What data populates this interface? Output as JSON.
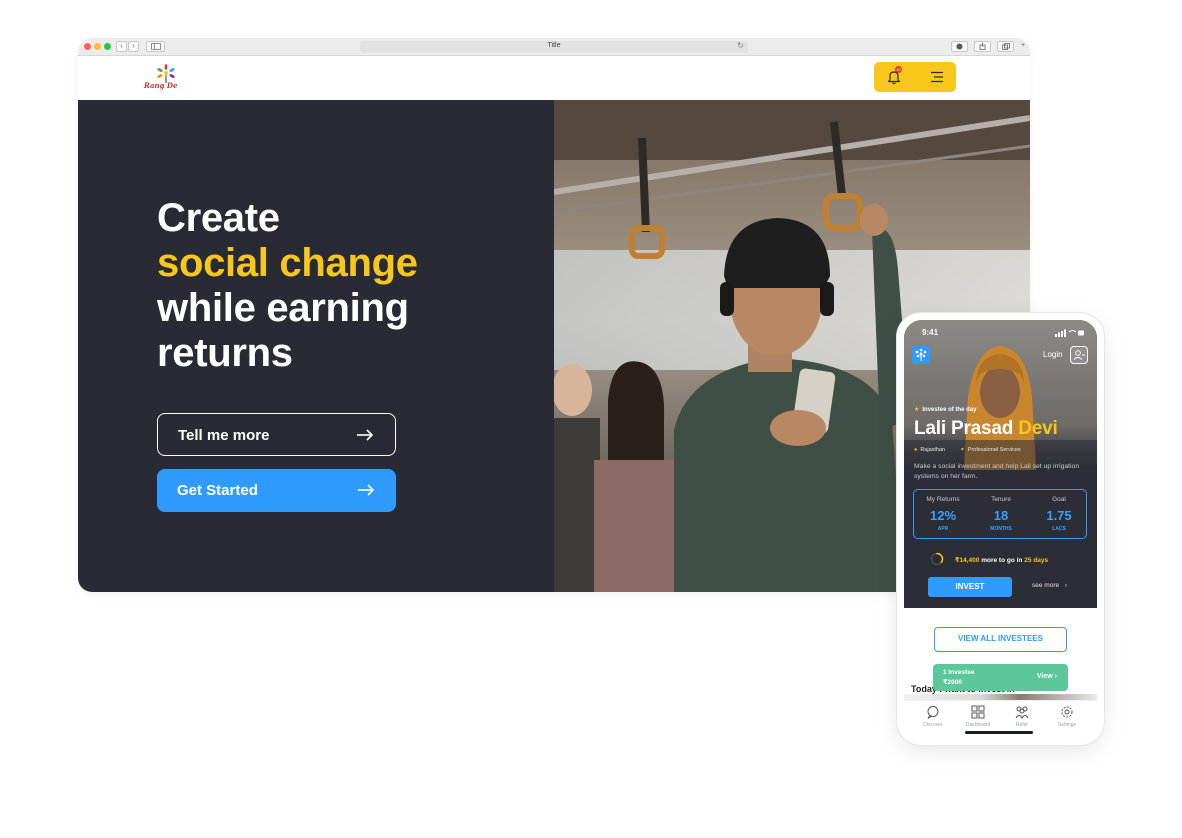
{
  "browser": {
    "url_title": "Title",
    "back_glyph": "‹",
    "forward_glyph": "›",
    "reload_glyph": "↻"
  },
  "site": {
    "logo_text": "Rang De",
    "notification_count": "10",
    "icons": {
      "bell": "bell-icon",
      "menu": "menu-icon"
    },
    "accent_color": "#f7c81a",
    "primary_color": "#2f9bff",
    "hero_bg_color": "#282b33"
  },
  "hero": {
    "line1": "Create",
    "line2": "social change",
    "line3": "while earning",
    "line4": "returns",
    "cta_secondary": "Tell me more",
    "cta_primary": "Get Started"
  },
  "phone": {
    "time": "9:41",
    "login_label": "Login",
    "investee_label": "Investee of the day",
    "first_name": "Lali Prasad",
    "last_name": "Devi",
    "location": "Rajasthan",
    "category": "Professional Services",
    "description": "Make a social investment and help Lali set up irrigation systems on her farm.",
    "stats": [
      {
        "label": "My Returns",
        "value": "12%",
        "unit": "APR"
      },
      {
        "label": "Tenure",
        "value": "18",
        "unit": "MONTHS"
      },
      {
        "label": "Goal",
        "value": "1.75",
        "unit": "LACS"
      }
    ],
    "progress_fraction": 0.35,
    "remaining_amount": "₹14,400",
    "remaining_mid": "more to go in",
    "remaining_days": "25 days",
    "invest_label": "INVEST",
    "see_more_label": "see more",
    "view_all_label": "VIEW ALL INVESTEES",
    "section_title": "Today I want to invest in",
    "toast": {
      "line1": "1 Investee",
      "line2": "₹2000",
      "action": "View"
    },
    "tabs": [
      {
        "label": "Discover",
        "icon": "chat-bubble-icon"
      },
      {
        "label": "Dashboard",
        "icon": "grid-icon"
      },
      {
        "label": "Refer",
        "icon": "people-icon"
      },
      {
        "label": "Settings",
        "icon": "gear-icon"
      }
    ]
  }
}
